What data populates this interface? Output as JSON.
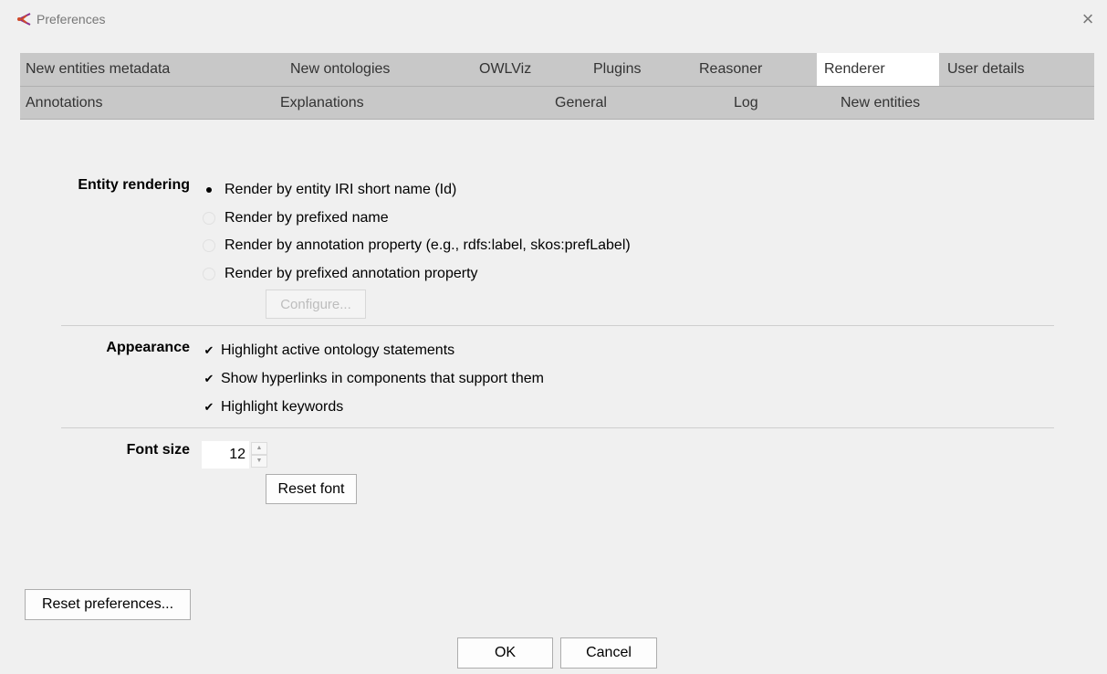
{
  "window": {
    "title": "Preferences",
    "close_icon": "×"
  },
  "tabs_row1": [
    "New entities metadata",
    "New ontologies",
    "OWLViz",
    "Plugins",
    "Reasoner",
    "Renderer",
    "User details"
  ],
  "tabs_row2": [
    "Annotations",
    "Explanations",
    "General",
    "Log",
    "New entities"
  ],
  "selected_tab": "Renderer",
  "entity_rendering": {
    "label": "Entity rendering",
    "options": [
      "Render by entity IRI short name (Id)",
      "Render by prefixed name",
      "Render by annotation property (e.g., rdfs:label, skos:prefLabel)",
      "Render by prefixed annotation property"
    ],
    "selected_index": 0,
    "configure_label": "Configure..."
  },
  "appearance": {
    "label": "Appearance",
    "options": [
      "Highlight active ontology statements",
      "Show hyperlinks in components that support them",
      "Highlight keywords"
    ],
    "checked": [
      true,
      true,
      true
    ]
  },
  "font_size": {
    "label": "Font size",
    "value": "12",
    "reset_label": "Reset font"
  },
  "footer": {
    "reset_preferences_label": "Reset preferences...",
    "ok_label": "OK",
    "cancel_label": "Cancel"
  },
  "colors": {
    "tab_bar": "#c8c8c8",
    "selected_tab": "#ffffff",
    "background": "#f0f0f0"
  }
}
